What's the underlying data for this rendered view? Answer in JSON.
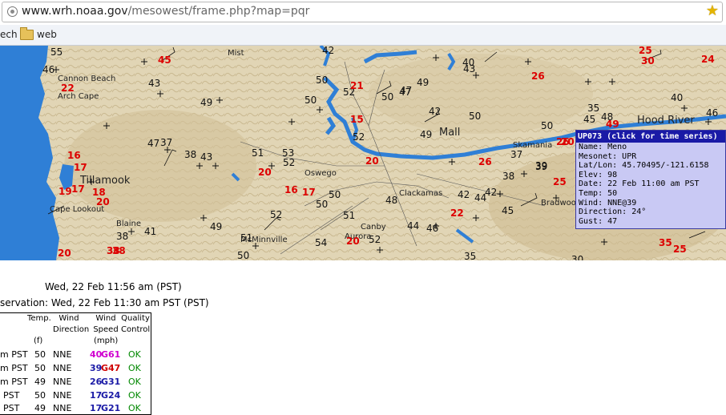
{
  "browser": {
    "url_domain": "www.wrh.noaa.gov",
    "url_path": "/mesowest/frame.php?map=pqr",
    "bookmarks": [
      "ech",
      "web"
    ]
  },
  "map": {
    "places": [
      "Mist",
      "Cannon Beach",
      "Arch Cape",
      "Tillamook",
      "Cape Lookout",
      "Blaine",
      "McMinnville",
      "Aurora",
      "Canby",
      "Hood River",
      "Mall",
      "Skamania",
      "Oswego",
      "Bradwood",
      "Clackamas"
    ],
    "black_numbers": [
      "55",
      "46",
      "43",
      "49",
      "50",
      "42",
      "40",
      "43",
      "47",
      "49",
      "50",
      "52",
      "50",
      "47",
      "42",
      "35",
      "48",
      "50",
      "45",
      "37",
      "43",
      "38",
      "47",
      "51",
      "53",
      "50",
      "52",
      "49",
      "44",
      "42",
      "45",
      "39",
      "38",
      "42",
      "48",
      "52",
      "51",
      "52",
      "38",
      "41",
      "49",
      "50",
      "51",
      "52",
      "54",
      "46",
      "44",
      "37",
      "35",
      "39",
      "46",
      "40",
      "50",
      "50",
      "30"
    ],
    "red_numbers": [
      "45",
      "22",
      "25",
      "30",
      "24",
      "26",
      "21",
      "15",
      "16",
      "17",
      "19",
      "17",
      "18",
      "20",
      "16",
      "17",
      "20",
      "20",
      "22",
      "26",
      "25",
      "26",
      "20",
      "38",
      "38",
      "49",
      "35",
      "25",
      "20",
      "20"
    ],
    "colors": {
      "water": "#2f7fd6",
      "land": "#e0d4b4",
      "hills": "#cdbb94",
      "station_text": "#111111",
      "gust_text": "#dd0000"
    }
  },
  "popup": {
    "title": "UP073 (click for time series)",
    "lines": [
      "Name: Meno",
      "Mesonet: UPR",
      "Lat/Lon: 45.70495/-121.6158",
      "Elev: 98",
      "Date: 22 Feb 11:00 am PST",
      "Temp: 50",
      "Wind: NNE@39",
      "Direction: 24°",
      "Gust: 47"
    ]
  },
  "times": {
    "line1": "Wed, 22 Feb 11:56 am (PST)",
    "line2": "servation: Wed, 22 Feb 11:30 am PST (PST)"
  },
  "table": {
    "headers": {
      "temp": "Temp.",
      "temp_unit": "(f)",
      "wind_dir": "Wind Direction",
      "wind_speed": "Wind Speed",
      "wind_unit": "(mph)",
      "quality": "Quality Control"
    },
    "rows": [
      {
        "time": "m PST",
        "temp": "50",
        "dir": "NNE",
        "speed": "40",
        "gust": "G61",
        "speed_color": "#d000d0",
        "gust_color": "#d000d0",
        "qc": "OK"
      },
      {
        "time": "m PST",
        "temp": "50",
        "dir": "NNE",
        "speed": "39",
        "gust": "G47",
        "speed_color": "#1a1aa6",
        "gust_color": "#d00000",
        "qc": "OK"
      },
      {
        "time": "m PST",
        "temp": "49",
        "dir": "NNE",
        "speed": "26",
        "gust": "G31",
        "speed_color": "#1a1aa6",
        "gust_color": "#1a1aa6",
        "qc": "OK"
      },
      {
        "time": "PST",
        "temp": "50",
        "dir": "NNE",
        "speed": "17",
        "gust": "G24",
        "speed_color": "#1a1aa6",
        "gust_color": "#1a1aa6",
        "qc": "OK"
      },
      {
        "time": "PST",
        "temp": "49",
        "dir": "NNE",
        "speed": "17",
        "gust": "G21",
        "speed_color": "#1a1aa6",
        "gust_color": "#1a1aa6",
        "qc": "OK"
      }
    ]
  }
}
